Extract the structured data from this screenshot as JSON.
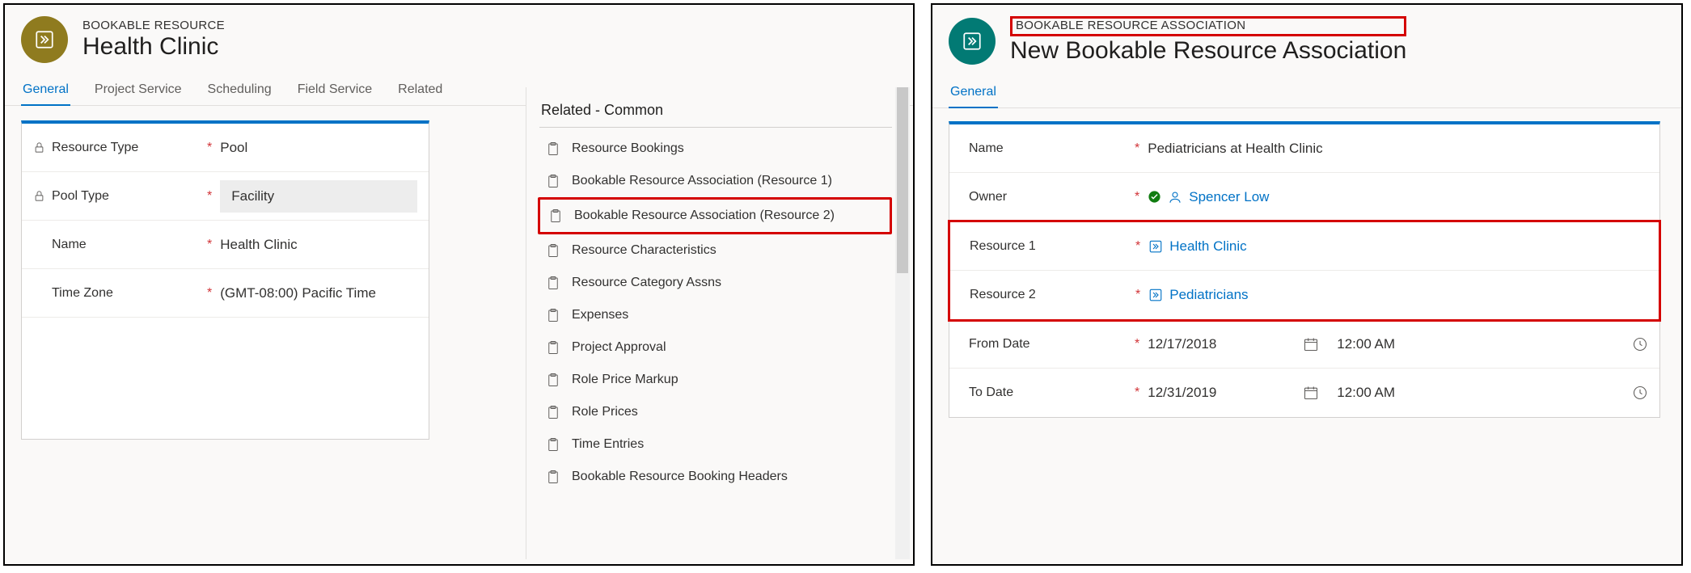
{
  "left": {
    "entity_label": "BOOKABLE RESOURCE",
    "entity_title": "Health Clinic",
    "tabs": [
      "General",
      "Project Service",
      "Scheduling",
      "Field Service",
      "Related"
    ],
    "active_tab": 0,
    "fields": {
      "resource_type": {
        "label": "Resource Type",
        "value": "Pool",
        "locked": true,
        "required": true
      },
      "pool_type": {
        "label": "Pool Type",
        "value": "Facility",
        "locked": true,
        "required": true,
        "editable_bg": true
      },
      "name": {
        "label": "Name",
        "value": "Health Clinic",
        "required": true
      },
      "time_zone": {
        "label": "Time Zone",
        "value": "(GMT-08:00) Pacific Time",
        "required": true
      }
    },
    "related": {
      "heading": "Related - Common",
      "items": [
        "Resource Bookings",
        "Bookable Resource Association (Resource 1)",
        "Bookable Resource Association (Resource 2)",
        "Resource Characteristics",
        "Resource Category Assns",
        "Expenses",
        "Project Approval",
        "Role Price Markup",
        "Role Prices",
        "Time Entries",
        "Bookable Resource Booking Headers"
      ],
      "highlighted_index": 2
    }
  },
  "right": {
    "entity_label": "BOOKABLE RESOURCE ASSOCIATION",
    "entity_title": "New Bookable Resource Association",
    "tabs": [
      "General"
    ],
    "active_tab": 0,
    "fields": {
      "name": {
        "label": "Name",
        "value": "Pediatricians at Health Clinic",
        "required": true
      },
      "owner": {
        "label": "Owner",
        "value": "Spencer Low",
        "required": true
      },
      "res1": {
        "label": "Resource 1",
        "value": "Health Clinic",
        "required": true
      },
      "res2": {
        "label": "Resource 2",
        "value": "Pediatricians",
        "required": true
      },
      "from": {
        "label": "From Date",
        "date": "12/17/2018",
        "time": "12:00 AM",
        "required": true
      },
      "to": {
        "label": "To Date",
        "date": "12/31/2019",
        "time": "12:00 AM",
        "required": true
      }
    }
  }
}
